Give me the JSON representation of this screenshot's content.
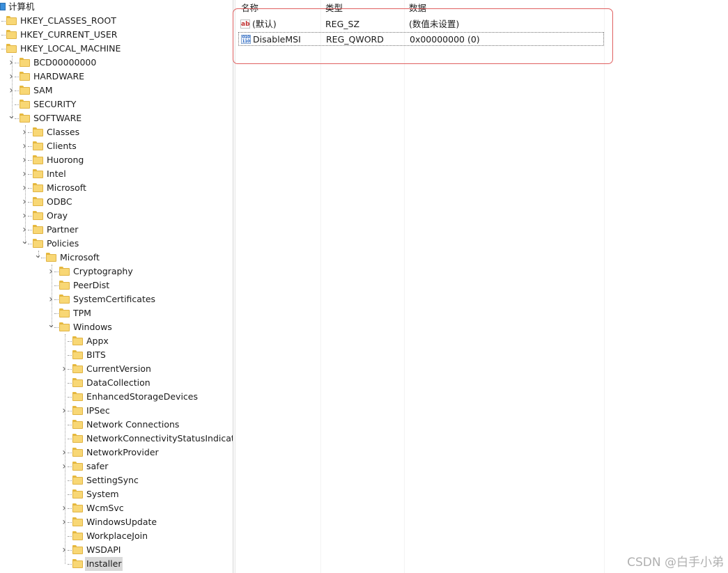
{
  "tree": {
    "root": "计算机",
    "nodes": [
      {
        "label": "HKEY_CLASSES_ROOT",
        "depth": 0,
        "expander": ">"
      },
      {
        "label": "HKEY_CURRENT_USER",
        "depth": 0,
        "expander": ">"
      },
      {
        "label": "HKEY_LOCAL_MACHINE",
        "depth": 0,
        "expander": "v"
      },
      {
        "label": "BCD00000000",
        "depth": 1,
        "expander": ">"
      },
      {
        "label": "HARDWARE",
        "depth": 1,
        "expander": ">"
      },
      {
        "label": "SAM",
        "depth": 1,
        "expander": ">"
      },
      {
        "label": "SECURITY",
        "depth": 1,
        "expander": ""
      },
      {
        "label": "SOFTWARE",
        "depth": 1,
        "expander": "v"
      },
      {
        "label": "Classes",
        "depth": 2,
        "expander": ">"
      },
      {
        "label": "Clients",
        "depth": 2,
        "expander": ">"
      },
      {
        "label": "Huorong",
        "depth": 2,
        "expander": ">"
      },
      {
        "label": "Intel",
        "depth": 2,
        "expander": ">"
      },
      {
        "label": "Microsoft",
        "depth": 2,
        "expander": ">"
      },
      {
        "label": "ODBC",
        "depth": 2,
        "expander": ">"
      },
      {
        "label": "Oray",
        "depth": 2,
        "expander": ">"
      },
      {
        "label": "Partner",
        "depth": 2,
        "expander": ">"
      },
      {
        "label": "Policies",
        "depth": 2,
        "expander": "v"
      },
      {
        "label": "Microsoft",
        "depth": 3,
        "expander": "v"
      },
      {
        "label": "Cryptography",
        "depth": 4,
        "expander": ">"
      },
      {
        "label": "PeerDist",
        "depth": 4,
        "expander": ""
      },
      {
        "label": "SystemCertificates",
        "depth": 4,
        "expander": ">"
      },
      {
        "label": "TPM",
        "depth": 4,
        "expander": ""
      },
      {
        "label": "Windows",
        "depth": 4,
        "expander": "v"
      },
      {
        "label": "Appx",
        "depth": 5,
        "expander": ""
      },
      {
        "label": "BITS",
        "depth": 5,
        "expander": ""
      },
      {
        "label": "CurrentVersion",
        "depth": 5,
        "expander": ">"
      },
      {
        "label": "DataCollection",
        "depth": 5,
        "expander": ""
      },
      {
        "label": "EnhancedStorageDevices",
        "depth": 5,
        "expander": ""
      },
      {
        "label": "IPSec",
        "depth": 5,
        "expander": ">"
      },
      {
        "label": "Network Connections",
        "depth": 5,
        "expander": ""
      },
      {
        "label": "NetworkConnectivityStatusIndicator",
        "depth": 5,
        "expander": ""
      },
      {
        "label": "NetworkProvider",
        "depth": 5,
        "expander": ">"
      },
      {
        "label": "safer",
        "depth": 5,
        "expander": ">"
      },
      {
        "label": "SettingSync",
        "depth": 5,
        "expander": ""
      },
      {
        "label": "System",
        "depth": 5,
        "expander": ""
      },
      {
        "label": "WcmSvc",
        "depth": 5,
        "expander": ">"
      },
      {
        "label": "WindowsUpdate",
        "depth": 5,
        "expander": ">"
      },
      {
        "label": "WorkplaceJoin",
        "depth": 5,
        "expander": ""
      },
      {
        "label": "WSDAPI",
        "depth": 5,
        "expander": ">"
      },
      {
        "label": "Installer",
        "depth": 5,
        "expander": "",
        "selected": true
      }
    ]
  },
  "columns": {
    "name": "名称",
    "type": "类型",
    "data": "数据"
  },
  "values": [
    {
      "icon": "ab",
      "name": "(默认)",
      "type": "REG_SZ",
      "data": "(数值未设置)"
    },
    {
      "icon": "binary",
      "name": "DisableMSI",
      "type": "REG_QWORD",
      "data": "0x00000000 (0)"
    }
  ],
  "icons": {
    "ab": "ab",
    "binary": "010\n110"
  },
  "colors": {
    "highlight": "#e06060",
    "folder": "#f8d775",
    "selection": "#d9d9d9"
  },
  "watermark": "CSDN @白手小弟"
}
